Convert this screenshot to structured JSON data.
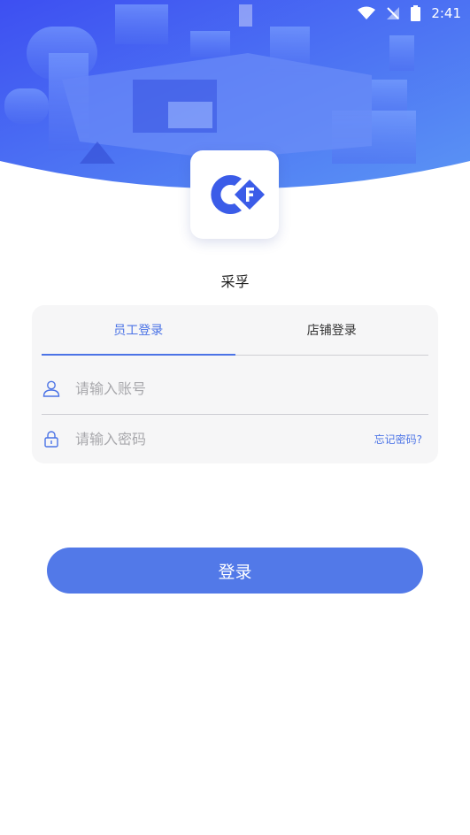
{
  "status_bar": {
    "time": "2:41"
  },
  "app": {
    "name": "采孚"
  },
  "tabs": [
    {
      "label": "员工登录",
      "active": true
    },
    {
      "label": "店铺登录",
      "active": false
    }
  ],
  "form": {
    "account_placeholder": "请输入账号",
    "password_placeholder": "请输入密码",
    "forgot_label": "忘记密码?"
  },
  "login_button": {
    "label": "登录"
  },
  "colors": {
    "accent": "#4b73e6",
    "button": "#5279e8",
    "hero_top": "#3f5cf5",
    "hero_bottom": "#5a8df2"
  }
}
